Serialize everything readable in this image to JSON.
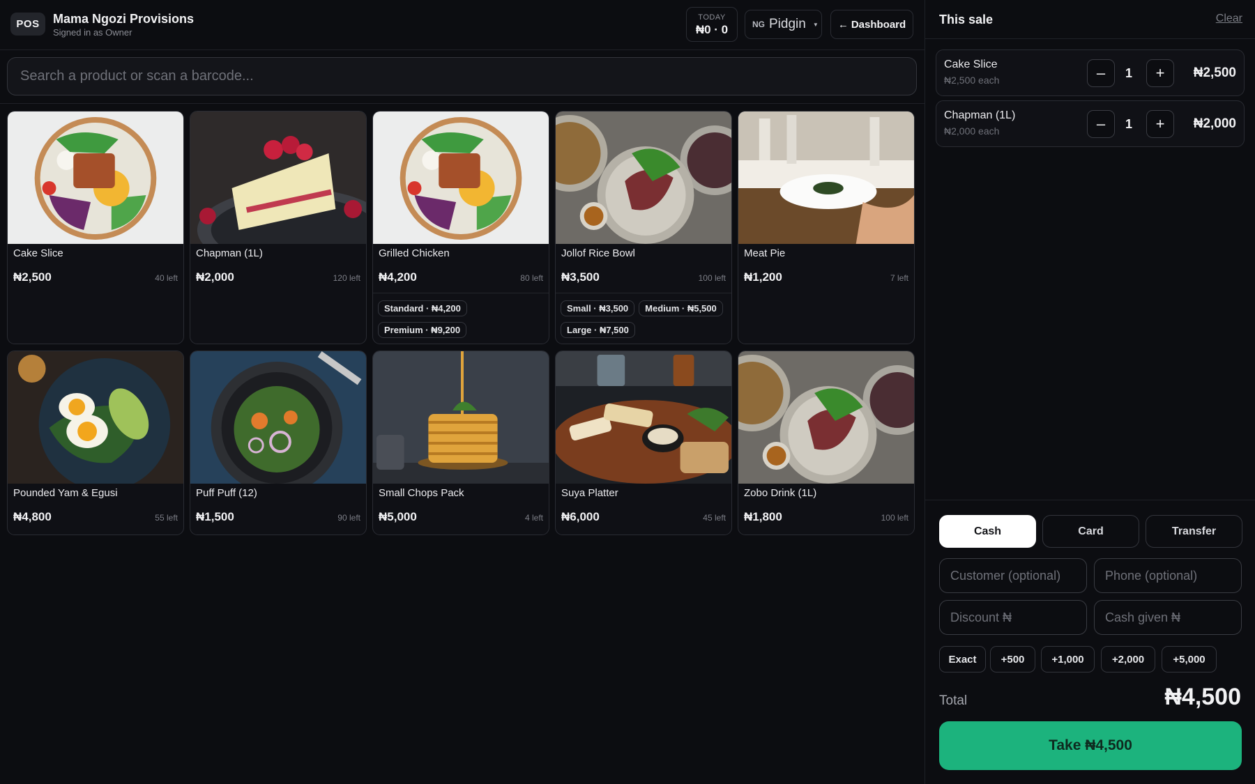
{
  "header": {
    "pos_badge": "POS",
    "store_name": "Mama Ngozi Provisions",
    "signed_in": "Signed in as Owner",
    "today_label": "TODAY",
    "today_value": "₦0 · 0",
    "language_flag": "NG",
    "language": "Pidgin",
    "dashboard_label": "Dashboard",
    "arrow_icon": "←"
  },
  "search": {
    "placeholder": "Search a product or scan a barcode..."
  },
  "products": [
    {
      "name": "Cake Slice",
      "price": "₦2,500",
      "stock": "40 left",
      "image": "salad-bowl",
      "variants": []
    },
    {
      "name": "Chapman (1L)",
      "price": "₦2,000",
      "stock": "120 left",
      "image": "cake-slice",
      "variants": []
    },
    {
      "name": "Grilled Chicken",
      "price": "₦4,200",
      "stock": "80 left",
      "image": "salad-bowl",
      "variants": [
        "Standard · ₦4,200",
        "Premium · ₦9,200"
      ]
    },
    {
      "name": "Jollof Rice Bowl",
      "price": "₦3,500",
      "stock": "100 left",
      "image": "steak-plates",
      "variants": [
        "Small · ₦3,500",
        "Medium · ₦5,500",
        "Large · ₦7,500"
      ]
    },
    {
      "name": "Meat Pie",
      "price": "₦1,200",
      "stock": "7 left",
      "image": "dinner-table",
      "variants": []
    },
    {
      "name": "Pounded Yam & Egusi",
      "price": "₦4,800",
      "stock": "55 left",
      "image": "egg-avocado",
      "variants": []
    },
    {
      "name": "Puff Puff (12)",
      "price": "₦1,500",
      "stock": "90 left",
      "image": "salad-plate",
      "variants": []
    },
    {
      "name": "Small Chops Pack",
      "price": "₦5,000",
      "stock": "4 left",
      "image": "pancake-stack",
      "variants": []
    },
    {
      "name": "Suya Platter",
      "price": "₦6,000",
      "stock": "45 left",
      "image": "grill-platter",
      "variants": []
    },
    {
      "name": "Zobo Drink (1L)",
      "price": "₦1,800",
      "stock": "100 left",
      "image": "steak-plates",
      "variants": []
    }
  ],
  "sale": {
    "title": "This sale",
    "clear_label": "Clear",
    "items": [
      {
        "name": "Cake Slice",
        "each": "₦2,500 each",
        "qty": "1",
        "total": "₦2,500"
      },
      {
        "name": "Chapman (1L)",
        "each": "₦2,000 each",
        "qty": "1",
        "total": "₦2,000"
      }
    ],
    "minus_icon": "–",
    "plus_icon": "+"
  },
  "payment": {
    "methods": [
      "Cash",
      "Card",
      "Transfer"
    ],
    "active_method": "Cash",
    "customer_placeholder": "Customer (optional)",
    "phone_placeholder": "Phone (optional)",
    "discount_placeholder": "Discount ₦",
    "cash_placeholder": "Cash given ₦",
    "quick_amounts": [
      "Exact",
      "+500",
      "+1,000",
      "+2,000",
      "+5,000"
    ],
    "total_label": "Total",
    "total_value": "₦4,500",
    "take_label": "Take ₦4,500"
  },
  "colors": {
    "background": "#0c0d11",
    "accent": "#1cb37d",
    "border": "#2a2c33"
  }
}
